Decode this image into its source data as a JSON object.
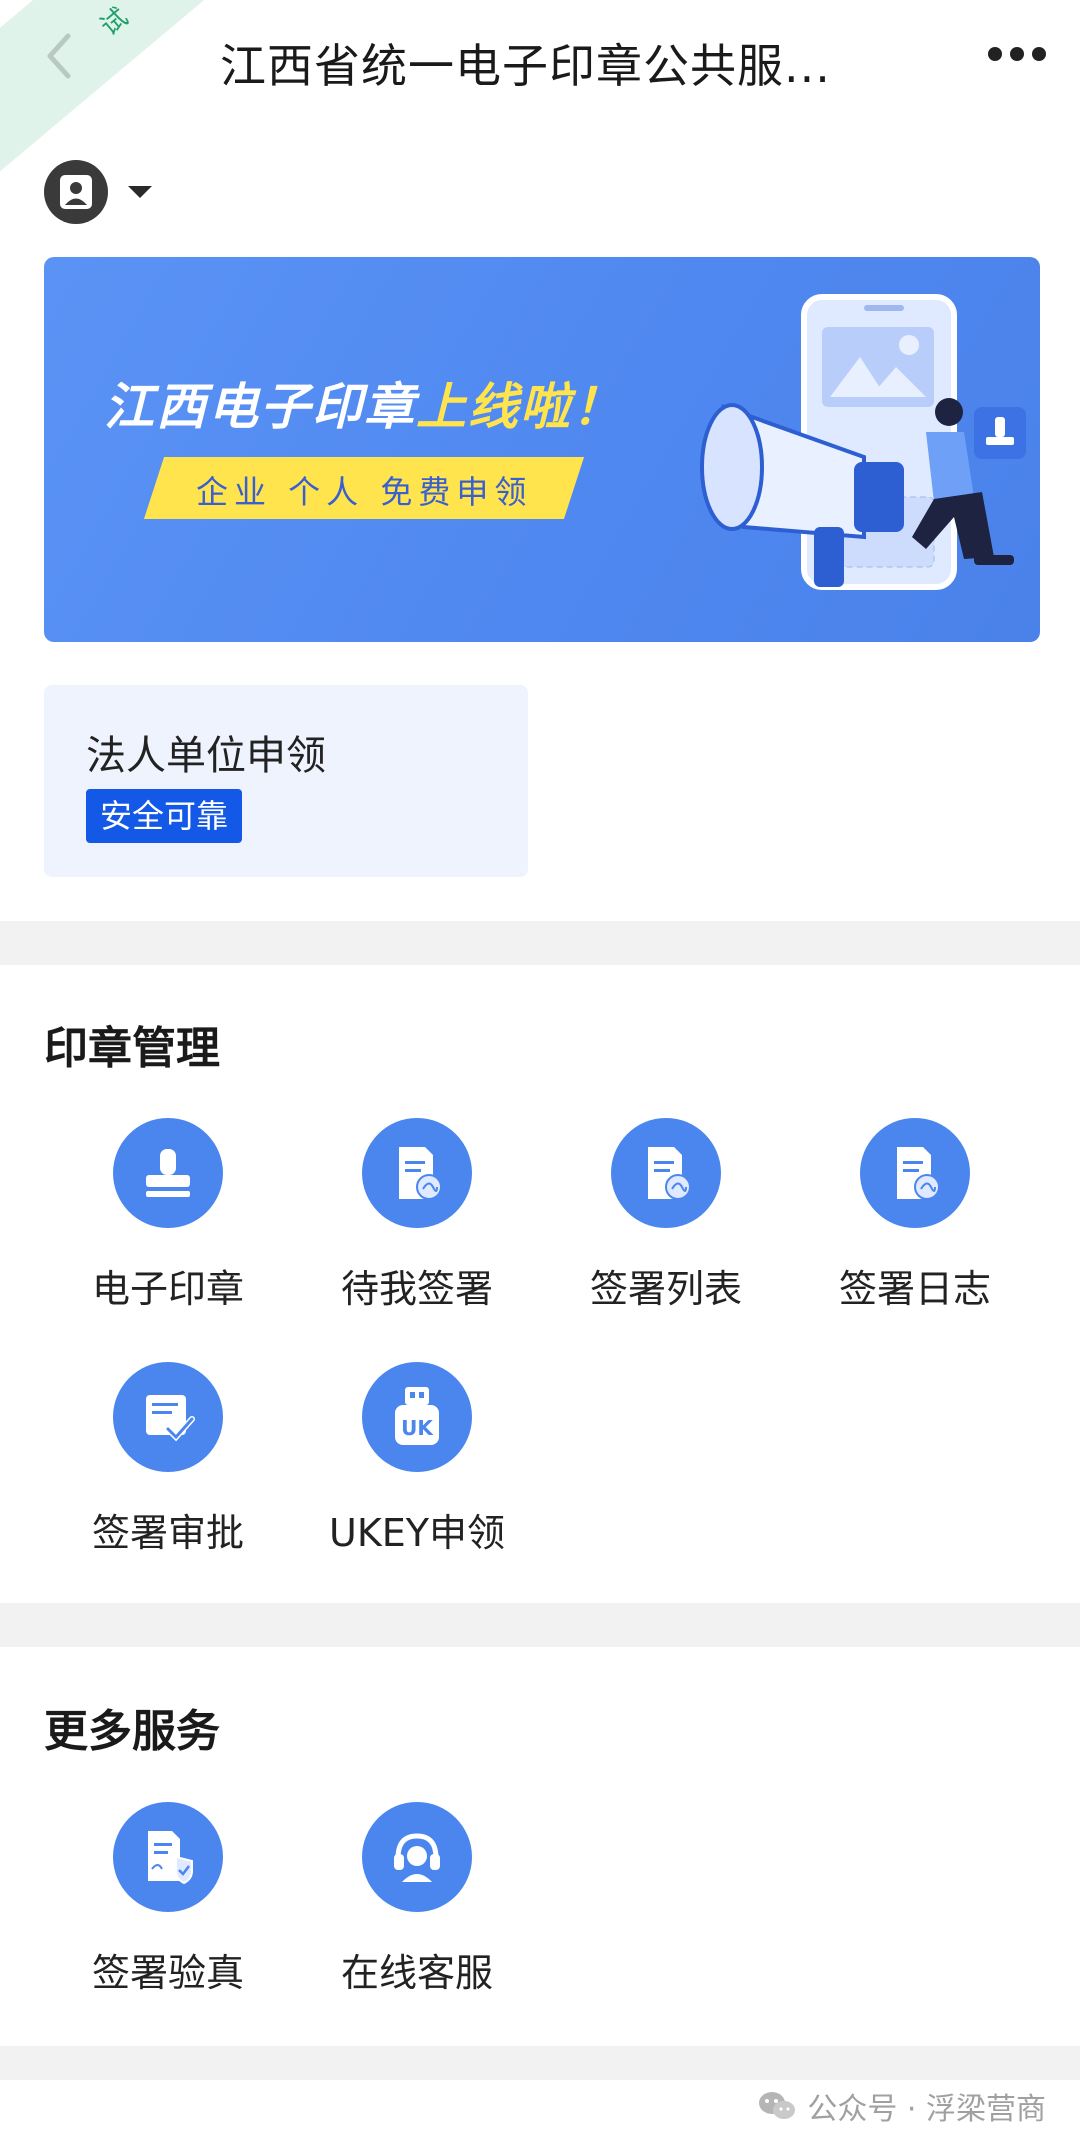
{
  "header": {
    "ribbon_text": "试",
    "title": "江西省统一电子印章公共服...",
    "back_icon": "chevron-left-icon",
    "more_icon": "more-dots-icon"
  },
  "account": {
    "avatar_icon": "user-id-icon",
    "dropdown_icon": "caret-down-icon"
  },
  "banner": {
    "title_main": "江西电子印章",
    "title_highlight": "上线啦！",
    "subtitle": "企业 个人 免费申领"
  },
  "entity_card": {
    "title": "法人单位申领",
    "tag": "安全可靠"
  },
  "seal_management": {
    "title": "印章管理",
    "items": [
      {
        "label": "电子印章",
        "icon": "stamp-icon"
      },
      {
        "label": "待我签署",
        "icon": "document-sign-icon"
      },
      {
        "label": "签署列表",
        "icon": "document-sign-icon"
      },
      {
        "label": "签署日志",
        "icon": "document-sign-icon"
      },
      {
        "label": "签署审批",
        "icon": "approval-check-icon"
      },
      {
        "label": "UKEY申领",
        "icon": "ukey-icon"
      }
    ]
  },
  "more_services": {
    "title": "更多服务",
    "items": [
      {
        "label": "签署验真",
        "icon": "document-verify-icon"
      },
      {
        "label": "在线客服",
        "icon": "headset-icon"
      }
    ]
  },
  "watermark": {
    "text": "公众号 · 浮梁营商",
    "icon": "wechat-icon"
  },
  "colors": {
    "accent": "#4a86ee",
    "tag_blue": "#1358e6",
    "banner_yellow": "#ffe44d",
    "card_bg": "#eef3fe",
    "divider": "#f2f2f2"
  }
}
